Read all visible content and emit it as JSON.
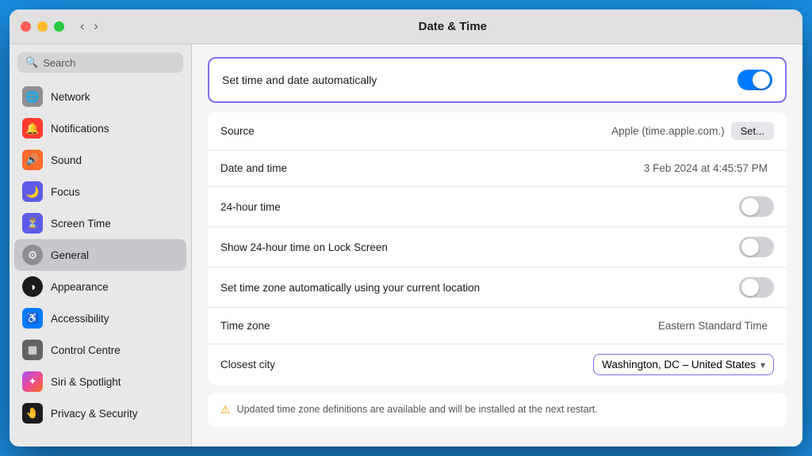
{
  "window": {
    "title": "Date & Time",
    "traffic_lights": {
      "close": "close",
      "minimize": "minimize",
      "maximize": "maximize"
    },
    "nav": {
      "back_label": "‹",
      "forward_label": "›"
    }
  },
  "sidebar": {
    "search_placeholder": "Search",
    "items": [
      {
        "id": "network",
        "label": "Network",
        "icon": "🌐",
        "icon_class": "icon-gray",
        "active": false
      },
      {
        "id": "notifications",
        "label": "Notifications",
        "icon": "🔔",
        "icon_class": "icon-red",
        "active": false
      },
      {
        "id": "sound",
        "label": "Sound",
        "icon": "🔊",
        "icon_class": "icon-orange",
        "active": false
      },
      {
        "id": "focus",
        "label": "Focus",
        "icon": "🌙",
        "icon_class": "icon-indigo",
        "active": false
      },
      {
        "id": "screentime",
        "label": "Screen Time",
        "icon": "⏳",
        "icon_class": "icon-indigo",
        "active": false
      },
      {
        "id": "general",
        "label": "General",
        "icon": "⚙",
        "icon_class": "icon-general",
        "active": false
      },
      {
        "id": "appearance",
        "label": "Appearance",
        "icon": "◑",
        "icon_class": "icon-appearance",
        "active": false
      },
      {
        "id": "accessibility",
        "label": "Accessibility",
        "icon": "♿",
        "icon_class": "icon-accessibility",
        "active": false
      },
      {
        "id": "controlcentre",
        "label": "Control Centre",
        "icon": "▦",
        "icon_class": "icon-controlcentre",
        "active": false
      },
      {
        "id": "siri",
        "label": "Siri & Spotlight",
        "icon": "✦",
        "icon_class": "icon-siri",
        "active": false
      },
      {
        "id": "privacy",
        "label": "Privacy & Security",
        "icon": "🤚",
        "icon_class": "icon-privacy",
        "active": false
      }
    ]
  },
  "main": {
    "auto_set": {
      "label": "Set time and date automatically",
      "enabled": true
    },
    "rows": [
      {
        "id": "source",
        "label": "Source",
        "value": "Apple (time.apple.com.)",
        "has_button": true,
        "button_label": "Set...",
        "has_toggle": false,
        "toggle_on": false,
        "has_dropdown": false
      },
      {
        "id": "datetime",
        "label": "Date and time",
        "value": "3 Feb 2024 at 4:45:57 PM",
        "has_button": false,
        "has_toggle": false,
        "toggle_on": false,
        "has_dropdown": false
      },
      {
        "id": "24hour",
        "label": "24-hour time",
        "value": "",
        "has_button": false,
        "has_toggle": true,
        "toggle_on": false,
        "has_dropdown": false
      },
      {
        "id": "24hourlockscreen",
        "label": "Show 24-hour time on Lock Screen",
        "value": "",
        "has_button": false,
        "has_toggle": true,
        "toggle_on": false,
        "has_dropdown": false
      },
      {
        "id": "timezone_auto",
        "label": "Set time zone automatically using your current location",
        "value": "",
        "has_button": false,
        "has_toggle": true,
        "toggle_on": false,
        "has_dropdown": false
      },
      {
        "id": "timezone",
        "label": "Time zone",
        "value": "Eastern Standard Time",
        "has_button": false,
        "has_toggle": false,
        "toggle_on": false,
        "has_dropdown": false
      },
      {
        "id": "closestcity",
        "label": "Closest city",
        "value": "",
        "has_button": false,
        "has_toggle": false,
        "toggle_on": false,
        "has_dropdown": true,
        "dropdown_value": "Washington, DC – United States"
      }
    ],
    "warning": {
      "text": "Updated time zone definitions are available and will be installed at the next restart."
    }
  }
}
